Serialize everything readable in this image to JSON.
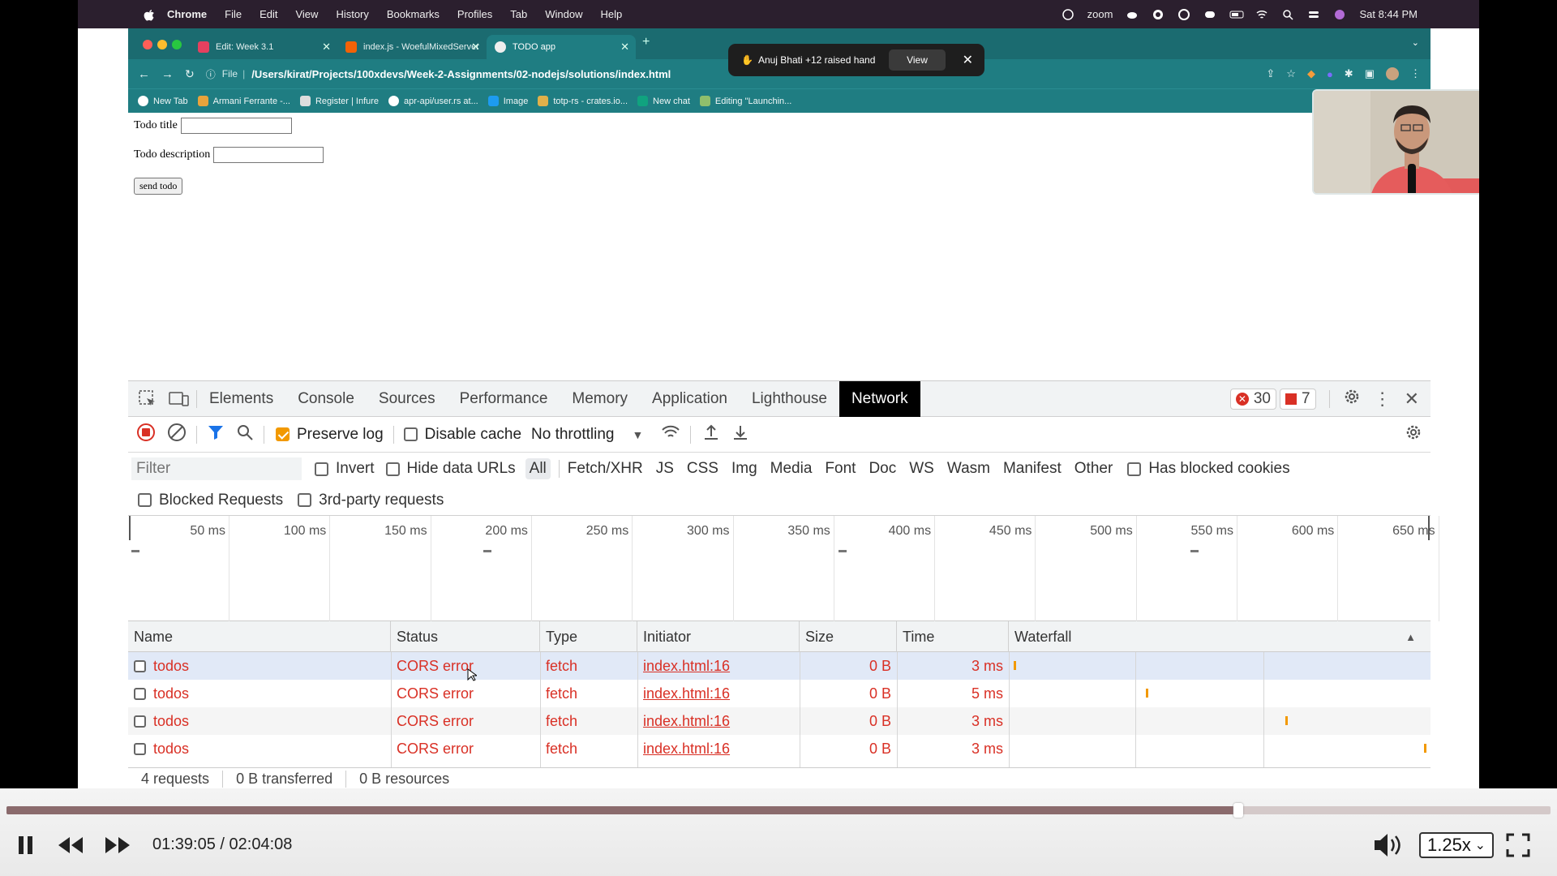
{
  "menubar": {
    "app": "Chrome",
    "items": [
      "File",
      "Edit",
      "View",
      "History",
      "Bookmarks",
      "Profiles",
      "Tab",
      "Window",
      "Help"
    ],
    "zoom_label": "zoom",
    "clock": "Sat 8:44 PM"
  },
  "browser": {
    "tabs": [
      {
        "title": "Edit: Week 3.1",
        "favicon_color": "#e4405f"
      },
      {
        "title": "index.js - WoefulMixedServer",
        "favicon_color": "#f26207"
      },
      {
        "title": "TODO app",
        "favicon_color": "#eeeeee"
      }
    ],
    "url_scheme": "File",
    "url": "/Users/kirat/Projects/100xdevs/Week-2-Assignments/02-nodejs/solutions/index.html",
    "bookmarks": [
      "New Tab",
      "Armani Ferrante -...",
      "Register | Infure",
      "apr-api/user.rs at...",
      "Image",
      "totp-rs - crates.io...",
      "New chat",
      "Editing \"Launchin..."
    ]
  },
  "notification": {
    "text": "Anuj Bhati +12 raised hand",
    "action": "View"
  },
  "page": {
    "title_label": "Todo title",
    "description_label": "Todo description",
    "send_button": "send todo"
  },
  "devtools": {
    "tabs": [
      "Elements",
      "Console",
      "Sources",
      "Performance",
      "Memory",
      "Application",
      "Lighthouse",
      "Network"
    ],
    "active_tab": "Network",
    "error_count": "30",
    "issue_count": "7",
    "preserve_log": "Preserve log",
    "disable_cache": "Disable cache",
    "throttling": "No throttling",
    "filter_placeholder": "Filter",
    "invert": "Invert",
    "hide_data_urls": "Hide data URLs",
    "types": [
      "All",
      "Fetch/XHR",
      "JS",
      "CSS",
      "Img",
      "Media",
      "Font",
      "Doc",
      "WS",
      "Wasm",
      "Manifest",
      "Other"
    ],
    "has_blocked_cookies": "Has blocked cookies",
    "blocked_requests": "Blocked Requests",
    "third_party": "3rd-party requests",
    "overview_ticks": [
      "50 ms",
      "100 ms",
      "150 ms",
      "200 ms",
      "250 ms",
      "300 ms",
      "350 ms",
      "400 ms",
      "450 ms",
      "500 ms",
      "550 ms",
      "600 ms",
      "650 ms"
    ],
    "columns": [
      "Name",
      "Status",
      "Type",
      "Initiator",
      "Size",
      "Time",
      "Waterfall"
    ],
    "requests": [
      {
        "name": "todos",
        "status": "CORS error",
        "type": "fetch",
        "initiator": "index.html:16",
        "size": "0 B",
        "time": "3 ms"
      },
      {
        "name": "todos",
        "status": "CORS error",
        "type": "fetch",
        "initiator": "index.html:16",
        "size": "0 B",
        "time": "5 ms"
      },
      {
        "name": "todos",
        "status": "CORS error",
        "type": "fetch",
        "initiator": "index.html:16",
        "size": "0 B",
        "time": "3 ms"
      },
      {
        "name": "todos",
        "status": "CORS error",
        "type": "fetch",
        "initiator": "index.html:16",
        "size": "0 B",
        "time": "3 ms"
      }
    ],
    "summary": [
      "4 requests",
      "0 B transferred",
      "0 B resources"
    ]
  },
  "player": {
    "current_time": "01:39:05",
    "duration": "02:04:08",
    "time_text": "01:39:05 / 02:04:08",
    "progress_fraction": 0.798,
    "speed": "1.25x"
  },
  "colors": {
    "accent_teal": "#1f7d82",
    "error_red": "#d93025",
    "checkbox_orange": "#f29900"
  }
}
